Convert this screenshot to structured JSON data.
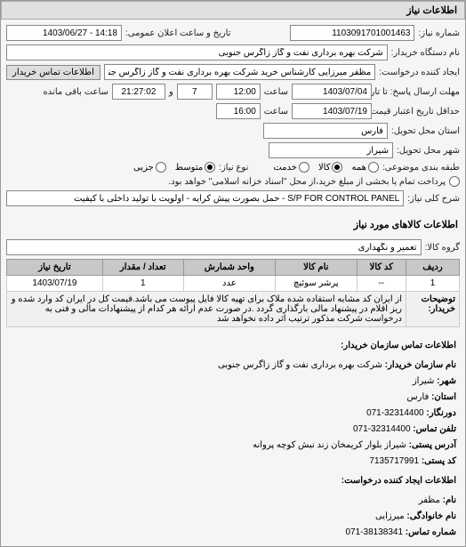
{
  "section_title": "اطلاعات نیاز",
  "req_no_label": "شماره نیاز:",
  "req_no": "1103091701001463",
  "announce_label": "تاریخ و ساعت اعلان عمومی:",
  "announce": "14:18 - 1403/06/27",
  "buyer_org_label": "نام دستگاه خریدار:",
  "buyer_org": "شرکت بهره برداری نفت و گاز زاگرس جنوبی",
  "creator_label": "ایجاد کننده درخواست:",
  "creator": "مظفر میرزایی کارشناس خرید شرکت بهره برداری نفت و گاز زاگرس جنوبی",
  "contact_btn": "اطلاعات تماس خریدار",
  "deadline_reply_label": "مهلت ارسال پاسخ: تا تاریخ:",
  "deadline_reply_date": "1403/07/04",
  "time_label": "ساعت",
  "deadline_reply_time": "12:00",
  "days_remain": "7",
  "countdown": "21:27:02",
  "remain_label": "ساعت باقی مانده",
  "price_deadline_label": "حداقل تاریخ اعتبار قیمت: تا تاریخ:",
  "price_deadline_date": "1403/07/19",
  "price_deadline_time": "16:00",
  "delivery_province_label": "استان محل تحویل:",
  "delivery_province": "فارس",
  "delivery_city_label": "شهر محل تحویل:",
  "delivery_city": "شیراز",
  "category_label": "طبقه بندی موضوعی:",
  "cat_all": "همه",
  "cat_goods": "کالا",
  "cat_service": "خدمت",
  "need_type_label": "نوع نیاز:",
  "need_medium": "متوسط",
  "need_partial": "جزیی",
  "payment_label": "پرداخت تمام یا بخشی از مبلغ خرید،از محل \"اسناد خزانه اسلامی\" خواهد بود.",
  "req_desc_label": "شرح کلی نیاز:",
  "req_desc": "S/P FOR CONTROL PANEL - حمل بصورت پیش کرایه - اولویت با تولید داخلی با کیفیت",
  "items_title": "اطلاعات کالاهای مورد نیاز",
  "group_label": "گروه کالا:",
  "group_value": "تعمیر و نگهداری",
  "table": {
    "headers": [
      "ردیف",
      "کد کالا",
      "نام کالا",
      "واحد شمارش",
      "تعداد / مقدار",
      "تاریخ نیاز"
    ],
    "rows": [
      [
        "1",
        "--",
        "پرشر سوئیچ",
        "عدد",
        "1",
        "1403/07/19"
      ]
    ]
  },
  "explain_label": "توضیحات خریدار:",
  "explain_text": "از ایران کد مشابه استفاده شده ملاک برای تهیه کالا فایل پیوست می باشد.قیمت کل در ایران کد وارد شده و ریز اقلام در پیشنهاد مالی بارگذاری گردد .در صورت عدم ارائه هر کدام از پیشنهادات مالی و فنی به درخواست شرکت مذکور ترتیب اثر داده نخواهد شد",
  "contact": {
    "title": "اطلاعات تماس سازمان خریدار:",
    "org_label": "نام سازمان خریدار:",
    "org": "شرکت بهره برداری نفت و گاز زاگرس جنوبی",
    "city_label": "شهر:",
    "city": "شیراز",
    "province_label": "استان:",
    "province": "فارس",
    "fax_label": "دورنگار:",
    "fax": "32314400-071",
    "phone_label": "تلفن تماس:",
    "phone": "32314400-071",
    "addr_label": "آدرس پستی:",
    "addr": "شیراز بلوار کریمخان زند نبش کوچه پروانه",
    "postal_label": "کد پستی:",
    "postal": "7135717991",
    "creator_info_label": "اطلاعات ایجاد کننده درخواست:",
    "name_label": "نام:",
    "name": "مظفر",
    "lname_label": "نام خانوادگی:",
    "lname": "میرزایی",
    "cphone_label": "شماره تماس:",
    "cphone": "38138341-071"
  }
}
